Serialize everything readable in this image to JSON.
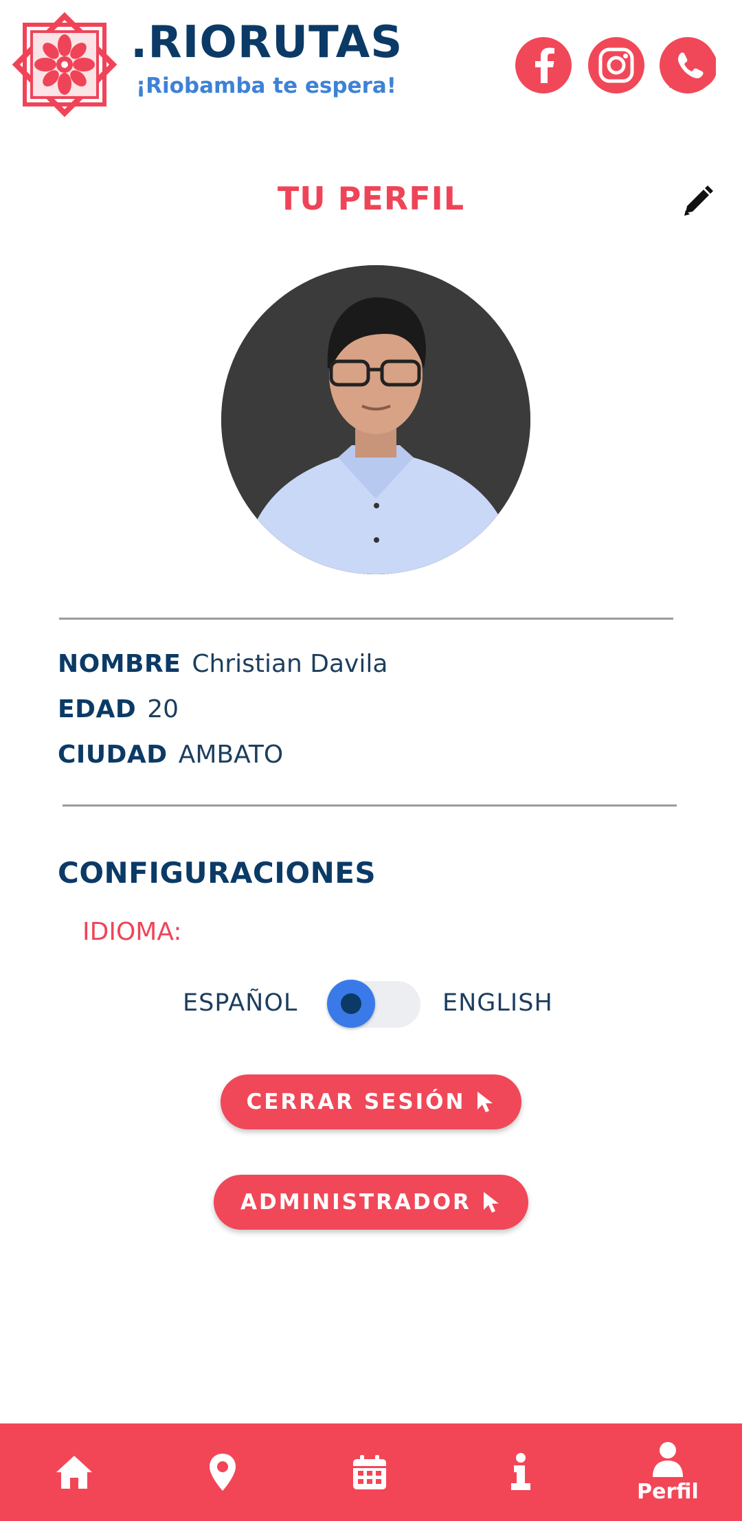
{
  "header": {
    "brand_title": ".RIORUTAS",
    "brand_subtitle": "¡Riobamba te espera!",
    "logo_icon": "ornament-logo-icon",
    "social": [
      {
        "name": "facebook-icon"
      },
      {
        "name": "instagram-icon"
      },
      {
        "name": "whatsapp-icon"
      }
    ]
  },
  "profile": {
    "title": "TU PERFIL",
    "edit_icon": "pencil-icon",
    "fields": {
      "name_label": "NOMBRE",
      "name_value": "Christian Davila",
      "age_label": "EDAD",
      "age_value": "20",
      "city_label": "CIUDAD",
      "city_value": "AMBATO"
    }
  },
  "settings": {
    "title": "CONFIGURACIONES",
    "language_label": "IDIOMA:",
    "language_left": "ESPAÑOL",
    "language_right": "ENGLISH",
    "language_selected": "ESPAÑOL"
  },
  "actions": {
    "logout_label": "CERRAR SESIÓN",
    "admin_label": "ADMINISTRADOR"
  },
  "bottom_nav": {
    "items": [
      {
        "icon": "home-icon"
      },
      {
        "icon": "map-pin-icon"
      },
      {
        "icon": "calendar-icon"
      },
      {
        "icon": "info-icon"
      },
      {
        "icon": "user-icon",
        "label": "Perfil",
        "active": true
      }
    ]
  },
  "colors": {
    "accent": "#f04858",
    "navy": "#0b3a66",
    "subtitle_blue": "#3d82d6",
    "toggle_blue": "#3a7ae8"
  }
}
